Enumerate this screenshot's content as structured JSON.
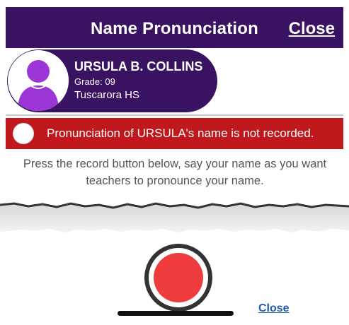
{
  "header": {
    "title": "Name Pronunciation",
    "close_label": "Close"
  },
  "student": {
    "name": "URSULA B. COLLINS",
    "grade": "Grade: 09",
    "school": "Tuscarora HS"
  },
  "notice": {
    "text": "Pronunciation of URSULA's name is not recorded."
  },
  "instructions": {
    "text": "Press the record button below, say your name as you want teachers to pronounce your name."
  },
  "footer": {
    "close_label": "Close"
  },
  "colors": {
    "brand_purple": "#3a1262",
    "alert_red": "#c0181d",
    "record_red": "#ee3b3b",
    "link_blue": "#1f5fb0"
  },
  "icons": {
    "avatar": "person-silhouette-icon",
    "radio": "radio-empty-icon",
    "record": "record-icon"
  }
}
